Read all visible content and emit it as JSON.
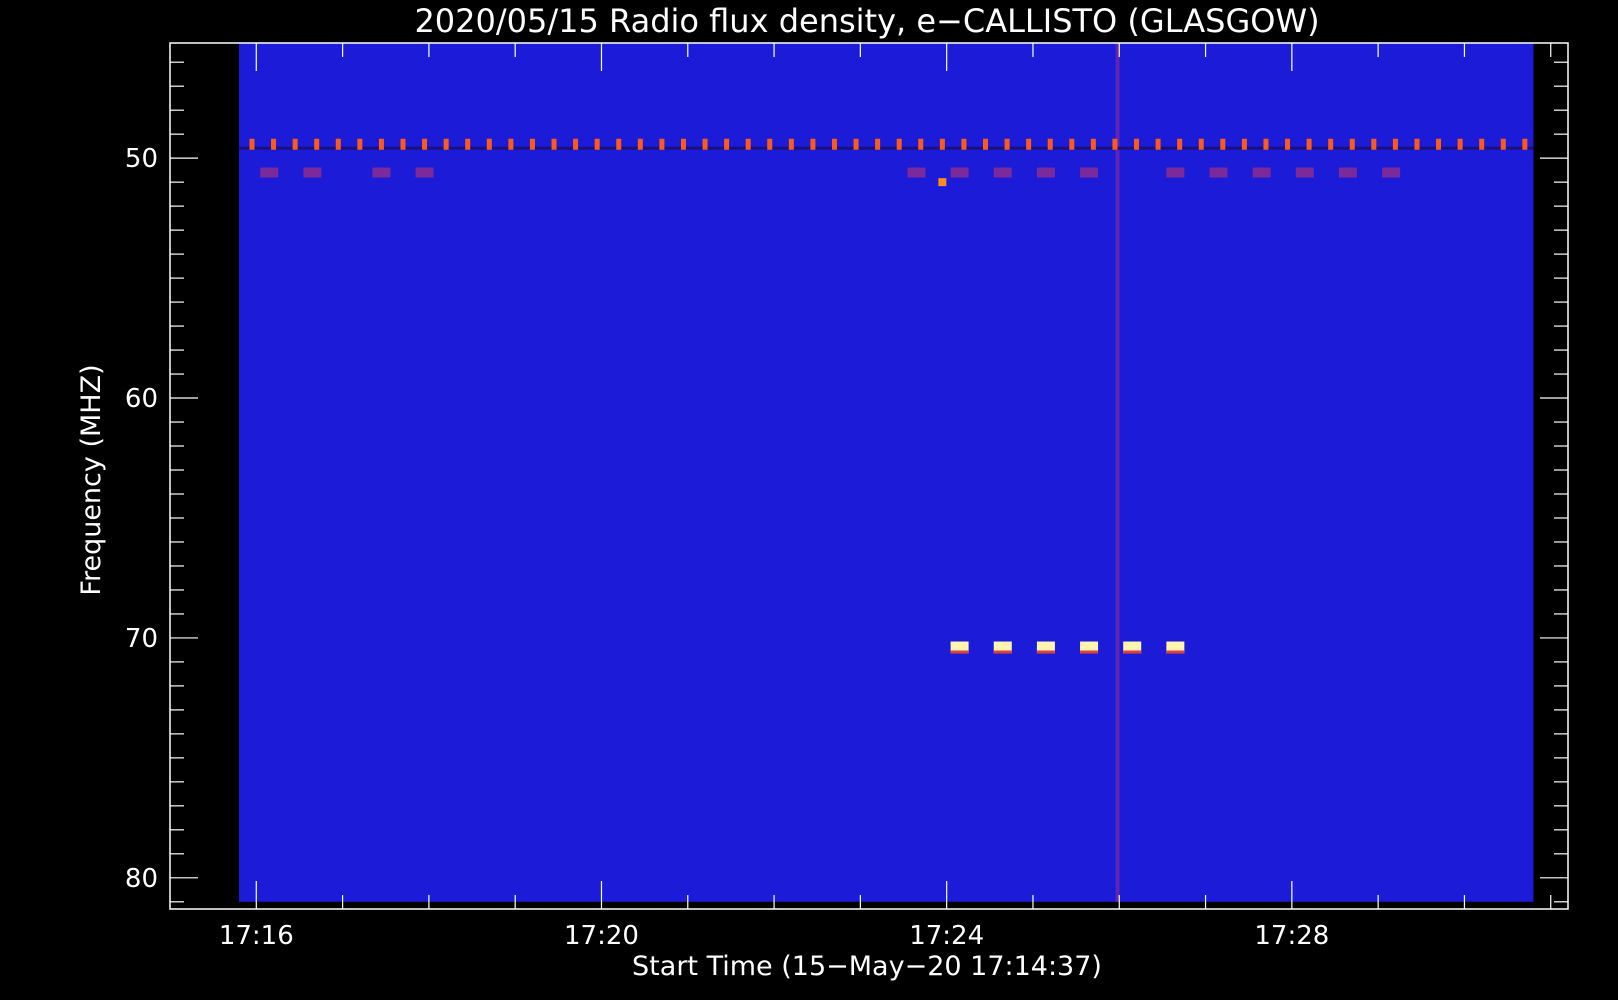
{
  "chart_data": {
    "type": "heatmap",
    "title": "2020/05/15  Radio flux density, e−CALLISTO (GLASGOW)",
    "xlabel": "Start Time (15−May−20 17:14:37)",
    "ylabel": "Frequency (MHZ)",
    "x_tick_labels": [
      "17:16",
      "17:20",
      "17:24",
      "17:28"
    ],
    "y_tick_labels": [
      "50",
      "60",
      "70",
      "80"
    ],
    "y_inverted": true,
    "ylim": [
      45.2,
      81.3
    ],
    "xlim_minutes": [
      0,
      16.2
    ],
    "data_x_minutes": [
      0.8,
      15.8
    ],
    "data_y_mhz": [
      45.2,
      81.0
    ],
    "colormap": "blue-red-yellow-white",
    "background_color": "#1b1bd8",
    "features": {
      "band_49mhz": {
        "freq_mhz": 49.4,
        "start_min": 0.95,
        "end_min": 15.75,
        "step_min": 0.25,
        "color": "#ff5a1e"
      },
      "band_50_6mhz": {
        "freq_mhz": 50.6,
        "minutes": [
          1.15,
          1.65,
          2.45,
          2.95,
          8.65,
          9.15,
          9.65,
          10.15,
          10.65,
          11.65,
          12.15,
          12.65,
          13.15,
          13.65,
          14.15
        ],
        "color": "#7a2a9a"
      },
      "isolated_spot": {
        "freq_mhz": 51.0,
        "minute": 8.95,
        "color": "#ff8c1e"
      },
      "band_70_4mhz": {
        "freq_mhz": 70.4,
        "minutes": [
          9.15,
          9.65,
          10.15,
          10.65,
          11.15,
          11.65
        ],
        "color": "#fff4b0"
      },
      "vertical_spike": {
        "minute": 10.98,
        "from_mhz": 45.2,
        "to_mhz": 81.0,
        "color": "#7a2aa8"
      }
    }
  }
}
